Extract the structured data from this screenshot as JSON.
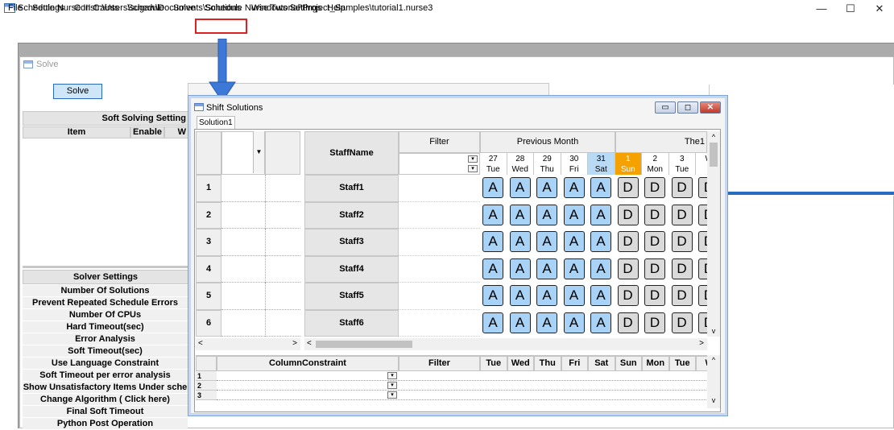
{
  "window": {
    "title": "Schedule Nurse III  C:\\Users\\sugaw\\Documents\\Schedule Nurse Tutorial\\Project_Samples\\tutorial1.nurse3",
    "minimize": "—",
    "maximize": "☐",
    "close": "✕"
  },
  "menu": [
    "File",
    "Settings",
    "Constraints",
    "Schedule",
    "Solve",
    "Solutions",
    "Windows Settings",
    "Help"
  ],
  "solve_window": {
    "title": "Solve",
    "solve_button": "Solve",
    "soft_settings_header": "Soft Solving Setting",
    "col_item": "Item",
    "col_enable": "Enable",
    "col_w": "W",
    "solver_settings_header": "Solver Settings",
    "solver_items": [
      "Number Of Solutions",
      "Prevent Repeated Schedule Errors",
      "Number Of CPUs",
      "Hard Timeout(sec)",
      "Error Analysis",
      "Soft Timeout(sec)",
      "Use Language Constraint",
      "Soft Timeout per error analysis",
      "Show Unsatisfactory Items Under sche",
      "Change Algorithm ( Click here)",
      "Final Soft Timeout",
      "Python Post Operation"
    ]
  },
  "shift_window": {
    "title": "Shift Solutions",
    "tab": "Solution1",
    "staffname_header": "StaffName",
    "filter_header": "Filter",
    "prev_month": "Previous Month",
    "next_month_partial": "The1",
    "days": [
      {
        "d": "27",
        "w": "Tue",
        "type": "prev"
      },
      {
        "d": "28",
        "w": "Wed",
        "type": "prev"
      },
      {
        "d": "29",
        "w": "Thu",
        "type": "prev"
      },
      {
        "d": "30",
        "w": "Fri",
        "type": "prev"
      },
      {
        "d": "31",
        "w": "Sat",
        "type": "sat"
      },
      {
        "d": "1",
        "w": "Sun",
        "type": "sun"
      },
      {
        "d": "2",
        "w": "Mon",
        "type": "cur"
      },
      {
        "d": "3",
        "w": "Tue",
        "type": "cur"
      },
      {
        "d": "",
        "w": "W",
        "type": "cur"
      }
    ],
    "rows": [
      {
        "num": "1",
        "name": "Staff1",
        "shifts": [
          "A",
          "A",
          "A",
          "A",
          "A",
          "D",
          "D",
          "D",
          "D"
        ]
      },
      {
        "num": "2",
        "name": "Staff2",
        "shifts": [
          "A",
          "A",
          "A",
          "A",
          "A",
          "D",
          "D",
          "D",
          "D"
        ]
      },
      {
        "num": "3",
        "name": "Staff3",
        "shifts": [
          "A",
          "A",
          "A",
          "A",
          "A",
          "D",
          "D",
          "D",
          "D"
        ]
      },
      {
        "num": "4",
        "name": "Staff4",
        "shifts": [
          "A",
          "A",
          "A",
          "A",
          "A",
          "D",
          "D",
          "D",
          "D"
        ]
      },
      {
        "num": "5",
        "name": "Staff5",
        "shifts": [
          "A",
          "A",
          "A",
          "A",
          "A",
          "D",
          "D",
          "D",
          "D"
        ]
      },
      {
        "num": "6",
        "name": "Staff6",
        "shifts": [
          "A",
          "A",
          "A",
          "A",
          "A",
          "D",
          "D",
          "D",
          "D"
        ]
      }
    ],
    "bottom": {
      "col_constraint_header": "ColumnConstraint",
      "filter_header": "Filter",
      "days": [
        "Tue",
        "Wed",
        "Thu",
        "Fri",
        "Sat",
        "Sun",
        "Mon",
        "Tue",
        "W"
      ],
      "rows": [
        "1",
        "2",
        "3"
      ]
    }
  },
  "colors": {
    "saturday": "#b8daf4",
    "sunday": "#f5a200",
    "shift_a": "#a8d2f6",
    "shift_d": "#dadada",
    "highlight": "#e02020",
    "arrow": "#3c78d8"
  }
}
